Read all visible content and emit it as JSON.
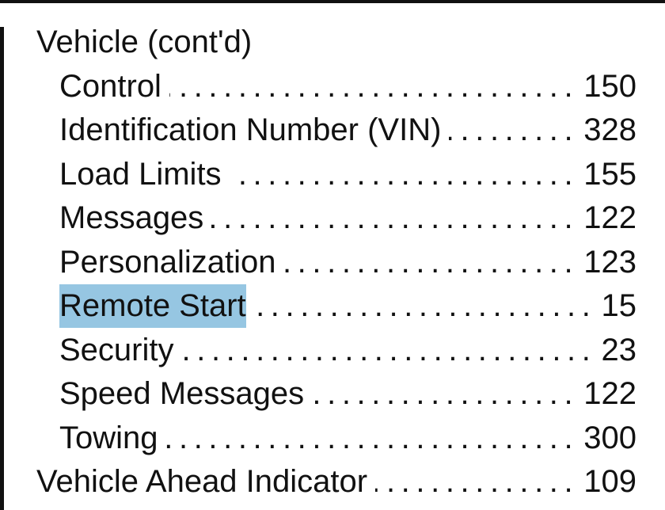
{
  "index": {
    "entries": [
      {
        "term": "Vehicle (cont'd)",
        "page": "",
        "level": 0,
        "heading": true
      },
      {
        "term": "Control",
        "page": "150",
        "level": 1
      },
      {
        "term": "Identification Number (VIN)",
        "page": "328",
        "level": 1
      },
      {
        "term": "Load Limits",
        "page": "155",
        "level": 1
      },
      {
        "term": "Messages",
        "page": "122",
        "level": 1
      },
      {
        "term": "Personalization",
        "page": "123",
        "level": 1
      },
      {
        "term": "Remote Start",
        "page": "15",
        "level": 1,
        "highlighted": true
      },
      {
        "term": "Security",
        "page": "23",
        "level": 1
      },
      {
        "term": "Speed Messages",
        "page": "122",
        "level": 1
      },
      {
        "term": "Towing",
        "page": "300",
        "level": 1
      },
      {
        "term": "Vehicle Ahead Indicator",
        "page": "109",
        "level": 0
      }
    ],
    "leader_dots": "................................................",
    "highlight_color": "#96c6e2"
  }
}
